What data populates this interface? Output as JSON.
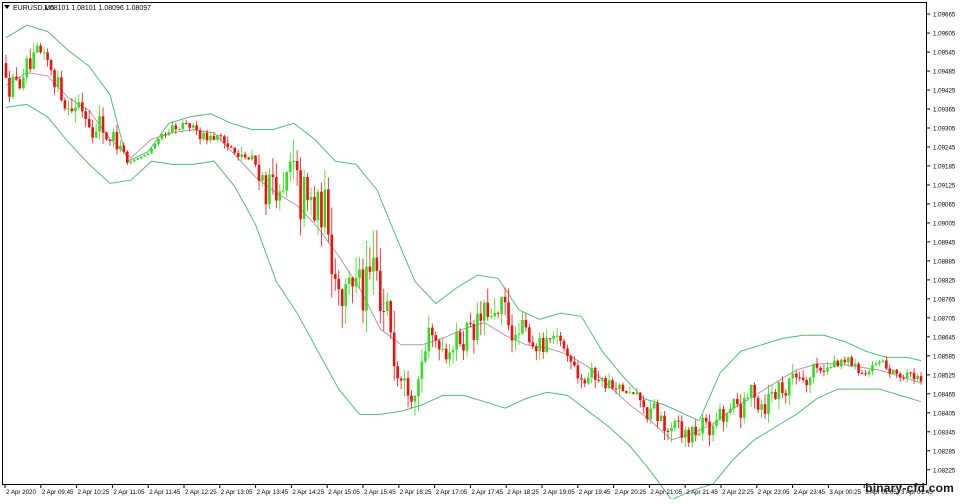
{
  "chart_data": {
    "type": "candlestick",
    "header_title": "EURUSD,M5",
    "header_ohlc": "1.08101 1.08101 1.08096 1.08097",
    "indicator": "bollinger-bands",
    "ylim": [
      1.0818,
      1.097
    ],
    "y_ticks": [
      "1.09665",
      "1.09605",
      "1.09545",
      "1.09485",
      "1.09425",
      "1.09365",
      "1.09305",
      "1.09245",
      "1.09185",
      "1.09125",
      "1.09065",
      "1.09005",
      "1.08945",
      "1.08885",
      "1.08825",
      "1.08765",
      "1.08705",
      "1.08645",
      "1.08585",
      "1.08525",
      "1.08465",
      "1.08405",
      "1.08345",
      "1.08285",
      "1.08225"
    ],
    "x_ticks": [
      "2 Apr 2020",
      "2 Apr 09:45",
      "2 Apr 10:25",
      "2 Apr 11:05",
      "2 Apr 11:45",
      "2 Apr 12:25",
      "2 Apr 13:05",
      "2 Apr 13:45",
      "2 Apr 14:25",
      "2 Apr 15:05",
      "2 Apr 15:45",
      "2 Apr 16:25",
      "2 Apr 17:05",
      "2 Apr 17:45",
      "2 Apr 18:25",
      "2 Apr 19:05",
      "2 Apr 19:45",
      "2 Apr 20:25",
      "2 Apr 21:05",
      "2 Apr 21:45",
      "2 Apr 22:25",
      "2 Apr 23:05",
      "2 Apr 23:45",
      "3 Apr 00:25",
      "3 Apr 01:05",
      "3 Apr 01:45"
    ],
    "bull_color": "#33dd22",
    "bear_color": "#ee1111",
    "band_color": "#55bb77",
    "mid_color": "#b89aa0",
    "bands": {
      "upper": [
        [
          0,
          1.0959
        ],
        [
          6,
          1.0963
        ],
        [
          12,
          1.0961
        ],
        [
          18,
          1.0955
        ],
        [
          24,
          1.095
        ],
        [
          30,
          1.0941
        ],
        [
          35,
          1.092
        ],
        [
          41,
          1.0923
        ],
        [
          47,
          1.0932
        ],
        [
          53,
          1.0934
        ],
        [
          59,
          1.0935
        ],
        [
          65,
          1.0932
        ],
        [
          71,
          1.093
        ],
        [
          77,
          1.093
        ],
        [
          83,
          1.0932
        ],
        [
          89,
          1.0927
        ],
        [
          95,
          1.092
        ],
        [
          101,
          1.0919
        ],
        [
          107,
          1.0911
        ],
        [
          113,
          1.0895
        ],
        [
          118,
          1.0882
        ],
        [
          124,
          1.0875
        ],
        [
          130,
          1.088
        ],
        [
          136,
          1.0884
        ],
        [
          142,
          1.0883
        ],
        [
          148,
          1.0873
        ],
        [
          154,
          1.087
        ],
        [
          160,
          1.0872
        ],
        [
          166,
          1.0871
        ],
        [
          172,
          1.086
        ],
        [
          178,
          1.0852
        ],
        [
          184,
          1.0845
        ],
        [
          190,
          1.0843
        ],
        [
          196,
          1.084
        ],
        [
          200,
          1.0838
        ],
        [
          206,
          1.0853
        ],
        [
          212,
          1.086
        ],
        [
          218,
          1.0862
        ],
        [
          224,
          1.0864
        ],
        [
          230,
          1.0865
        ],
        [
          236,
          1.0865
        ],
        [
          242,
          1.0863
        ],
        [
          248,
          1.086
        ],
        [
          254,
          1.0858
        ],
        [
          260,
          1.0858
        ],
        [
          264,
          1.0857
        ]
      ],
      "mid": [
        [
          0,
          1.0944
        ],
        [
          6,
          1.0948
        ],
        [
          12,
          1.0947
        ],
        [
          18,
          1.094
        ],
        [
          24,
          1.0936
        ],
        [
          30,
          1.0927
        ],
        [
          36,
          1.0921
        ],
        [
          42,
          1.0927
        ],
        [
          48,
          1.0929
        ],
        [
          54,
          1.093
        ],
        [
          60,
          1.0929
        ],
        [
          66,
          1.0922
        ],
        [
          72,
          1.0915
        ],
        [
          78,
          1.091
        ],
        [
          84,
          1.0906
        ],
        [
          90,
          1.0899
        ],
        [
          96,
          1.089
        ],
        [
          102,
          1.088
        ],
        [
          108,
          1.0867
        ],
        [
          114,
          1.0862
        ],
        [
          120,
          1.0862
        ],
        [
          126,
          1.0864
        ],
        [
          132,
          1.0867
        ],
        [
          138,
          1.0869
        ],
        [
          144,
          1.0865
        ],
        [
          150,
          1.0862
        ],
        [
          156,
          1.0861
        ],
        [
          162,
          1.0859
        ],
        [
          168,
          1.0855
        ],
        [
          174,
          1.0849
        ],
        [
          180,
          1.0843
        ],
        [
          186,
          1.0838
        ],
        [
          192,
          1.0832
        ],
        [
          198,
          1.0834
        ],
        [
          204,
          1.0837
        ],
        [
          210,
          1.0842
        ],
        [
          216,
          1.0846
        ],
        [
          222,
          1.085
        ],
        [
          228,
          1.0854
        ],
        [
          234,
          1.0856
        ],
        [
          240,
          1.0856
        ],
        [
          246,
          1.0855
        ],
        [
          252,
          1.0854
        ],
        [
          258,
          1.0852
        ],
        [
          264,
          1.085
        ]
      ],
      "lower": [
        [
          0,
          1.0937
        ],
        [
          6,
          1.0938
        ],
        [
          12,
          1.0934
        ],
        [
          18,
          1.0926
        ],
        [
          24,
          1.0919
        ],
        [
          30,
          1.0913
        ],
        [
          36,
          1.0914
        ],
        [
          42,
          1.092
        ],
        [
          48,
          1.0919
        ],
        [
          54,
          1.0919
        ],
        [
          60,
          1.092
        ],
        [
          66,
          1.0912
        ],
        [
          72,
          1.09
        ],
        [
          78,
          1.0882
        ],
        [
          84,
          1.0872
        ],
        [
          90,
          1.086
        ],
        [
          96,
          1.0848
        ],
        [
          102,
          1.084
        ],
        [
          108,
          1.084
        ],
        [
          114,
          1.0841
        ],
        [
          120,
          1.0843
        ],
        [
          126,
          1.0846
        ],
        [
          132,
          1.0846
        ],
        [
          138,
          1.0844
        ],
        [
          144,
          1.0842
        ],
        [
          150,
          1.0845
        ],
        [
          156,
          1.0847
        ],
        [
          162,
          1.0846
        ],
        [
          168,
          1.0841
        ],
        [
          174,
          1.0836
        ],
        [
          180,
          1.083
        ],
        [
          186,
          1.0822
        ],
        [
          192,
          1.0813
        ],
        [
          198,
          1.0816
        ],
        [
          204,
          1.0818
        ],
        [
          210,
          1.0826
        ],
        [
          216,
          1.0832
        ],
        [
          222,
          1.0836
        ],
        [
          228,
          1.084
        ],
        [
          234,
          1.0845
        ],
        [
          240,
          1.0848
        ],
        [
          246,
          1.0848
        ],
        [
          252,
          1.0848
        ],
        [
          258,
          1.0846
        ],
        [
          264,
          1.0844
        ]
      ]
    }
  },
  "watermark": "binary-cfd.com"
}
